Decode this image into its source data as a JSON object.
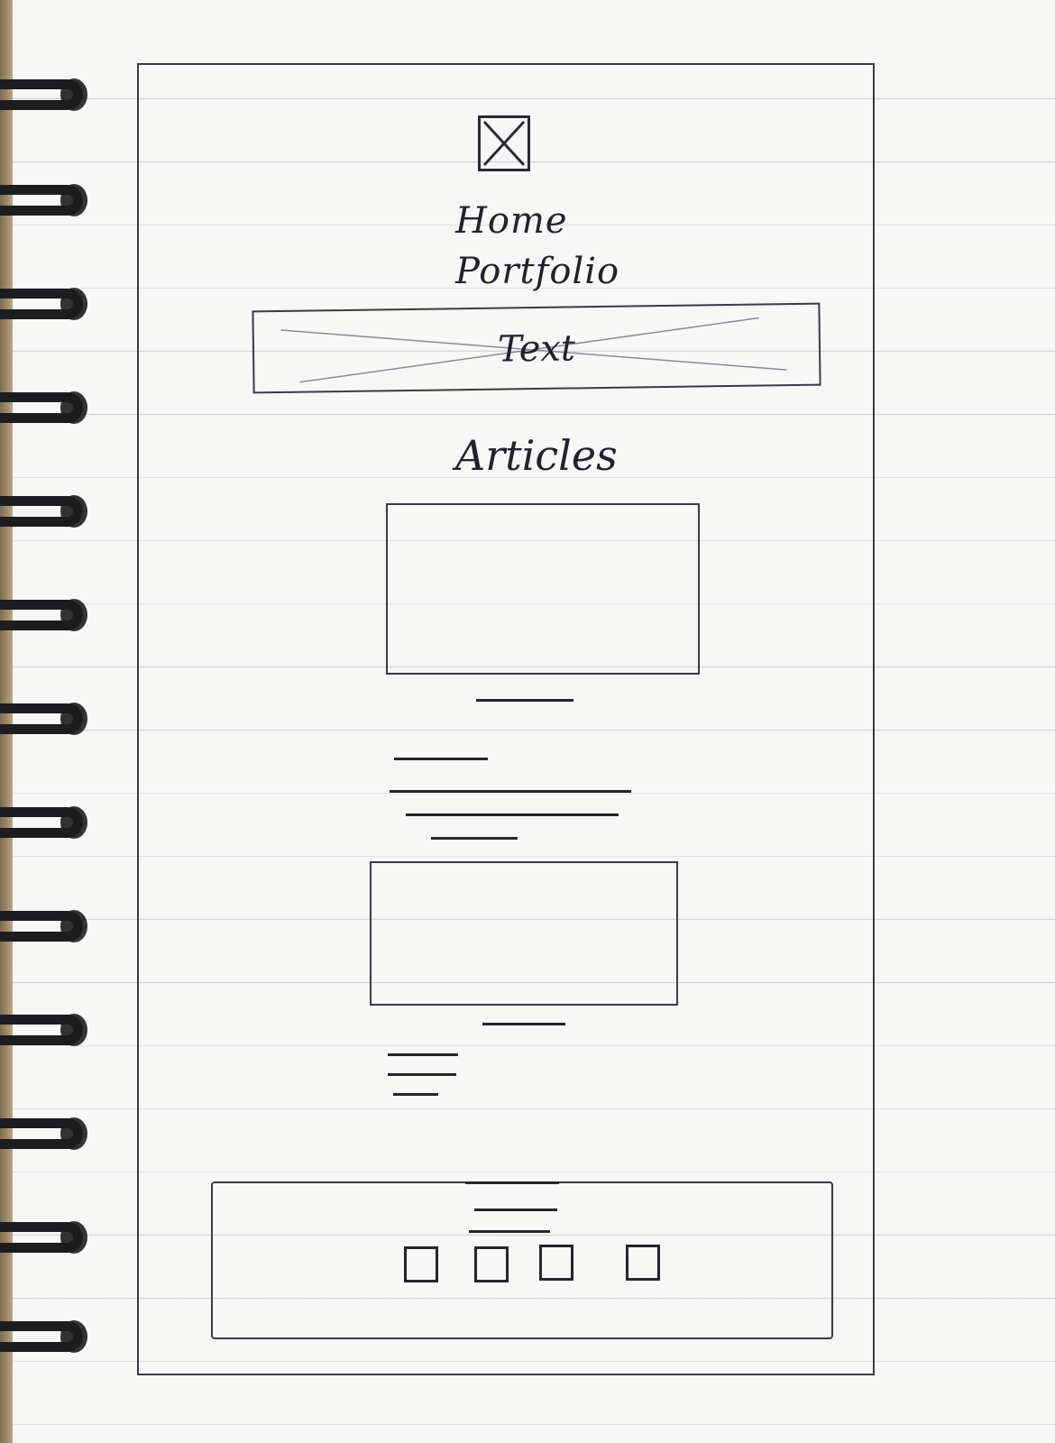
{
  "nav": {
    "items": [
      {
        "label": "Home"
      },
      {
        "label": "Portfolio"
      }
    ]
  },
  "banner": {
    "text": "Text"
  },
  "articles": {
    "title": "Articles",
    "count": 2
  },
  "footer": {
    "social_icons": 4
  }
}
